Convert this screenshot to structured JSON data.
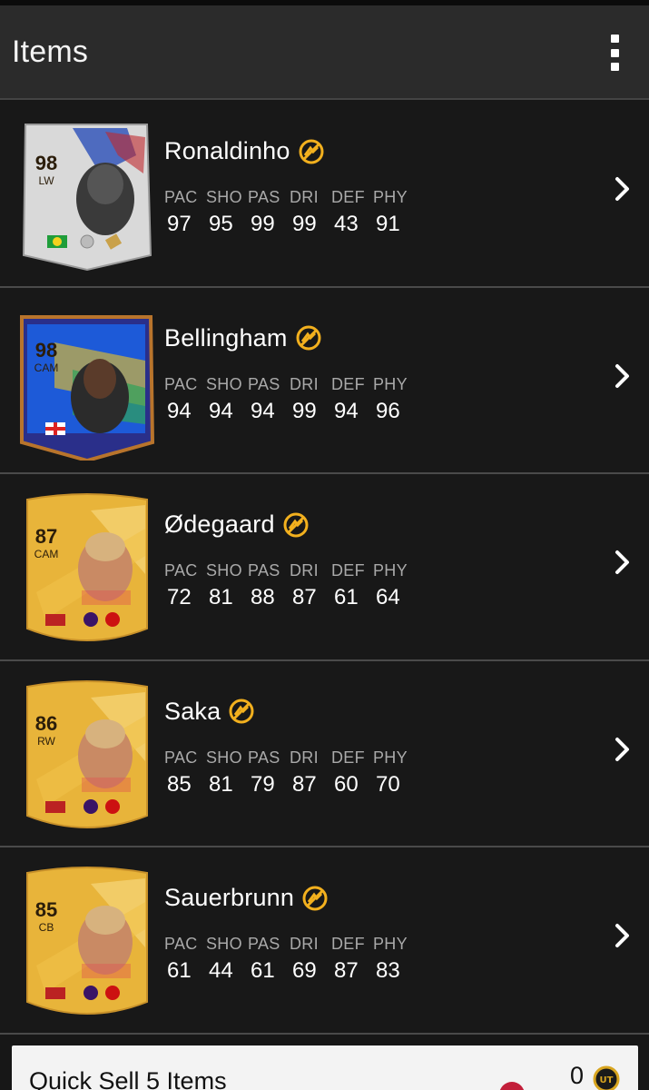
{
  "header": {
    "title": "Items",
    "menu_icon": "more-vertical-icon"
  },
  "colors": {
    "header_bg": "#2b2b2b",
    "row_bg": "#181818",
    "accent_gold": "#f2b01e"
  },
  "players": [
    {
      "name": "Ronaldinho",
      "rating": "98",
      "position": "LW",
      "card_style": "icon-white",
      "stats": {
        "PAC": "97",
        "SHO": "95",
        "PAS": "99",
        "DRI": "99",
        "DEF": "43",
        "PHY": "91"
      }
    },
    {
      "name": "Bellingham",
      "rating": "98",
      "position": "CAM",
      "card_style": "special-blue",
      "stats": {
        "PAC": "94",
        "SHO": "94",
        "PAS": "94",
        "DRI": "99",
        "DEF": "94",
        "PHY": "96"
      }
    },
    {
      "name": "Ødegaard",
      "rating": "87",
      "position": "CAM",
      "card_style": "gold",
      "stats": {
        "PAC": "72",
        "SHO": "81",
        "PAS": "88",
        "DRI": "87",
        "DEF": "61",
        "PHY": "64"
      }
    },
    {
      "name": "Saka",
      "rating": "86",
      "position": "RW",
      "card_style": "gold",
      "stats": {
        "PAC": "85",
        "SHO": "81",
        "PAS": "79",
        "DRI": "87",
        "DEF": "60",
        "PHY": "70"
      }
    },
    {
      "name": "Sauerbrunn",
      "rating": "85",
      "position": "CB",
      "card_style": "gold",
      "stats": {
        "PAC": "61",
        "SHO": "44",
        "PAS": "61",
        "DRI": "69",
        "DEF": "87",
        "PHY": "83"
      }
    }
  ],
  "stat_labels": [
    "PAC",
    "SHO",
    "PAS",
    "DRI",
    "DEF",
    "PHY"
  ],
  "footer": {
    "label": "Quick Sell 5 Items",
    "value": "0",
    "coin_icon": "ut-coin-icon"
  }
}
